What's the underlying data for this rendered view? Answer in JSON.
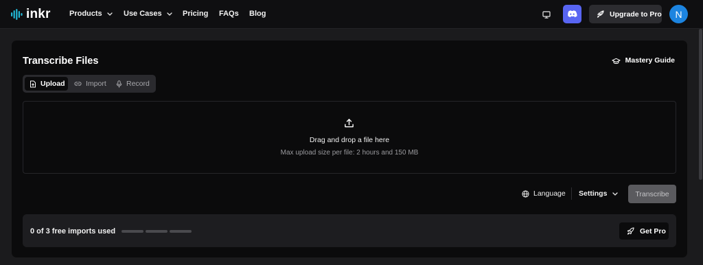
{
  "colors": {
    "page_bg": "#1b1b1d",
    "nav_bg": "#0f0f11",
    "card_bg": "#0b0b0c",
    "accent_logo": "#22b8d6",
    "discord": "#5865f2",
    "avatar": "#1c84e0"
  },
  "nav": {
    "logo_text": "inkr",
    "links": [
      {
        "label": "Products",
        "has_dropdown": true
      },
      {
        "label": "Use Cases",
        "has_dropdown": true
      },
      {
        "label": "Pricing",
        "has_dropdown": false
      },
      {
        "label": "FAQs",
        "has_dropdown": false
      },
      {
        "label": "Blog",
        "has_dropdown": false
      }
    ],
    "monitor_icon": "monitor-icon",
    "discord_icon": "discord-icon",
    "upgrade_label": "Upgrade to Pro",
    "upgrade_icon": "rocket-icon",
    "avatar_initial": "N"
  },
  "page": {
    "title": "Transcribe Files",
    "guide_label": "Mastery Guide",
    "guide_icon": "graduation-cap-icon",
    "tabs": [
      {
        "label": "Upload",
        "icon": "file-upload-icon",
        "active": true
      },
      {
        "label": "Import",
        "icon": "link-icon",
        "active": false
      },
      {
        "label": "Record",
        "icon": "microphone-icon",
        "active": false
      }
    ],
    "dropzone": {
      "icon": "upload-icon",
      "title": "Drag and drop a file here",
      "subtitle": "Max upload size per file: 2 hours and 150 MB"
    },
    "language_label": "Language",
    "language_icon": "globe-icon",
    "settings_label": "Settings",
    "transcribe_label": "Transcribe"
  },
  "usage": {
    "text": "0 of 3 free imports used",
    "used": 0,
    "total": 3,
    "get_pro_label": "Get Pro"
  }
}
